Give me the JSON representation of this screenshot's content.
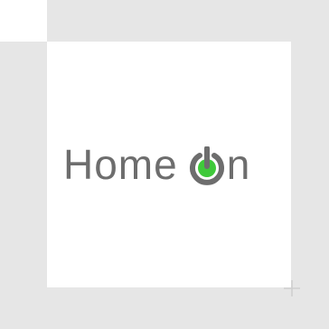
{
  "logo": {
    "word_home": "Home",
    "word_n": "n",
    "brand_gray": "#6d6d6d",
    "accent_green": "#3fc93a"
  },
  "icons": {
    "power": "power-icon",
    "corner": "plus-icon"
  },
  "colors": {
    "frame": "#e6e6e6",
    "background": "#ffffff"
  }
}
